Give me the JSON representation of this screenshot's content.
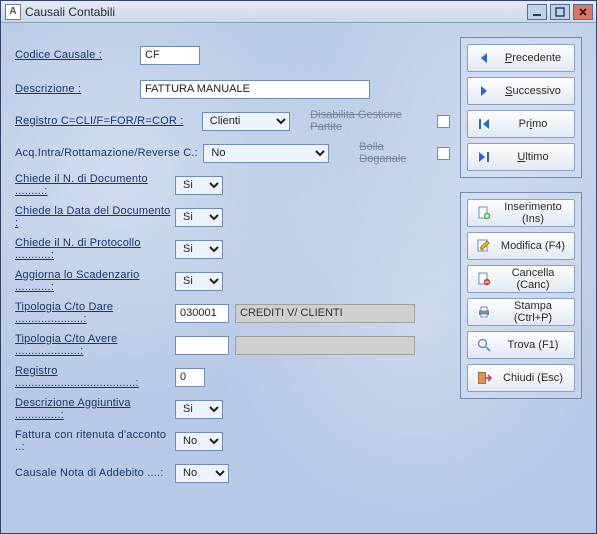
{
  "window": {
    "title": "Causali Contabili"
  },
  "form": {
    "codice_causale": {
      "label": "Codice Causale :",
      "value": "CF"
    },
    "descrizione": {
      "label": "Descrizione :",
      "value": "FATTURA MANUALE"
    },
    "registro_tipo": {
      "label": "Registro C=CLI/F=FOR/R=COR :",
      "value": "Clienti",
      "disabilita_label": "Disabilita Gestione Partite",
      "disabilita_checked": false
    },
    "acq_intra": {
      "label": "Acq.Intra/Rottamazione/Reverse C.:",
      "value": "No",
      "bolla_label": "Bolla Doganale",
      "bolla_checked": false
    },
    "chiede_ndoc": {
      "label": "Chiede il N. di Documento .........:",
      "value": "Si"
    },
    "chiede_data": {
      "label": "Chiede la Data del Documento :",
      "value": "Si"
    },
    "chiede_nprot": {
      "label": "Chiede il N. di Protocollo ...........:",
      "value": "Si"
    },
    "aggiorna_scad": {
      "label": "Aggiorna lo Scadenzario ...........:",
      "value": "Si"
    },
    "tip_dare": {
      "label": "Tipologia C/to Dare .....................:",
      "value": "030001",
      "readout": "CREDITI V/ CLIENTI"
    },
    "tip_avere": {
      "label": "Tipologia C/to Avere ....................:",
      "value": "",
      "readout": ""
    },
    "registro": {
      "label": "Registro .....................................:",
      "value": "0"
    },
    "descr_agg": {
      "label": "Descrizione Aggiuntiva ..............:",
      "value": "Si"
    },
    "fatt_ritenuta": {
      "label": "Fattura con ritenuta d'acconto ..:",
      "value": "No"
    },
    "causale_nota": {
      "label": "Causale Nota di Addebito ....:",
      "value": "No"
    }
  },
  "sidebar_nav": {
    "precedente": "Precedente",
    "successivo": "Successivo",
    "primo": "Primo",
    "ultimo": "Ultimo"
  },
  "sidebar_actions": {
    "inserimento": "Inserimento (Ins)",
    "modifica": "Modifica (F4)",
    "cancella": "Cancella (Canc)",
    "stampa": "Stampa (Ctrl+P)",
    "trova": "Trova (F1)",
    "chiudi": "Chiudi (Esc)"
  }
}
